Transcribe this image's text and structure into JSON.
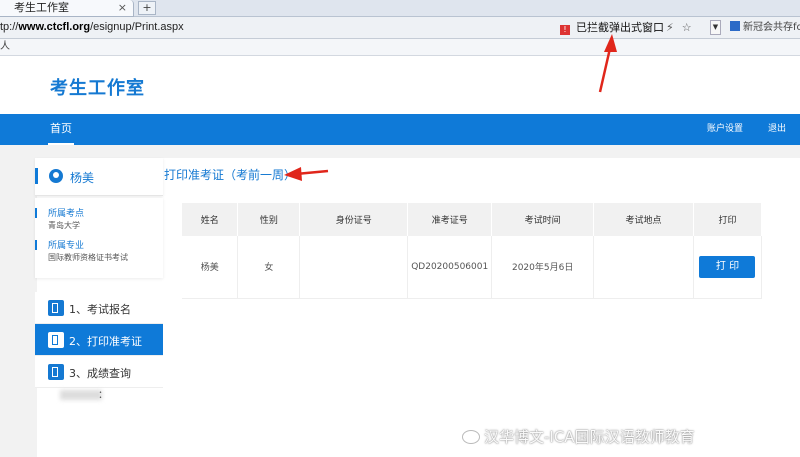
{
  "browser": {
    "tab_title": "考生工作室",
    "tab_close": "×",
    "new_tab": "+",
    "url_prefix": "tp://",
    "url_domain": "www.ctcfl.org",
    "url_path": "/esignup/Print.aspx",
    "popup_blocked": "已拦截弹出式窗口",
    "newsfeed": "新冠会共存fo",
    "bookmark_fragment": "人"
  },
  "header": {
    "site_title": "考生工作室"
  },
  "nav": {
    "home": "首页",
    "account": "账户设置",
    "logout": "退出"
  },
  "sidebar": {
    "user_name": "杨美",
    "school_label": "所属考点",
    "school_value": "青岛大学",
    "major_label": "所属专业",
    "major_value": "国际教师资格证书考试",
    "menu": [
      {
        "label": "1、考试报名"
      },
      {
        "label": "2、打印准考证"
      },
      {
        "label": "3、成绩查询"
      }
    ],
    "colon": "："
  },
  "main": {
    "section_title": "打印准考证（考前一周）",
    "table": {
      "headers": [
        "姓名",
        "性别",
        "身份证号",
        "准考证号",
        "考试时间",
        "考试地点",
        "打印"
      ],
      "row": {
        "name": "杨美",
        "gender": "女",
        "id_number": "",
        "ticket_number": "QD20200506001",
        "exam_time": "2020年5月6日",
        "exam_location": "",
        "print_label": "打 印"
      }
    }
  },
  "watermark": "汉华博文-ICA国际汉语教师教育",
  "colors": {
    "primary": "#0f7ad8",
    "annotation_arrow": "#e0261b"
  }
}
